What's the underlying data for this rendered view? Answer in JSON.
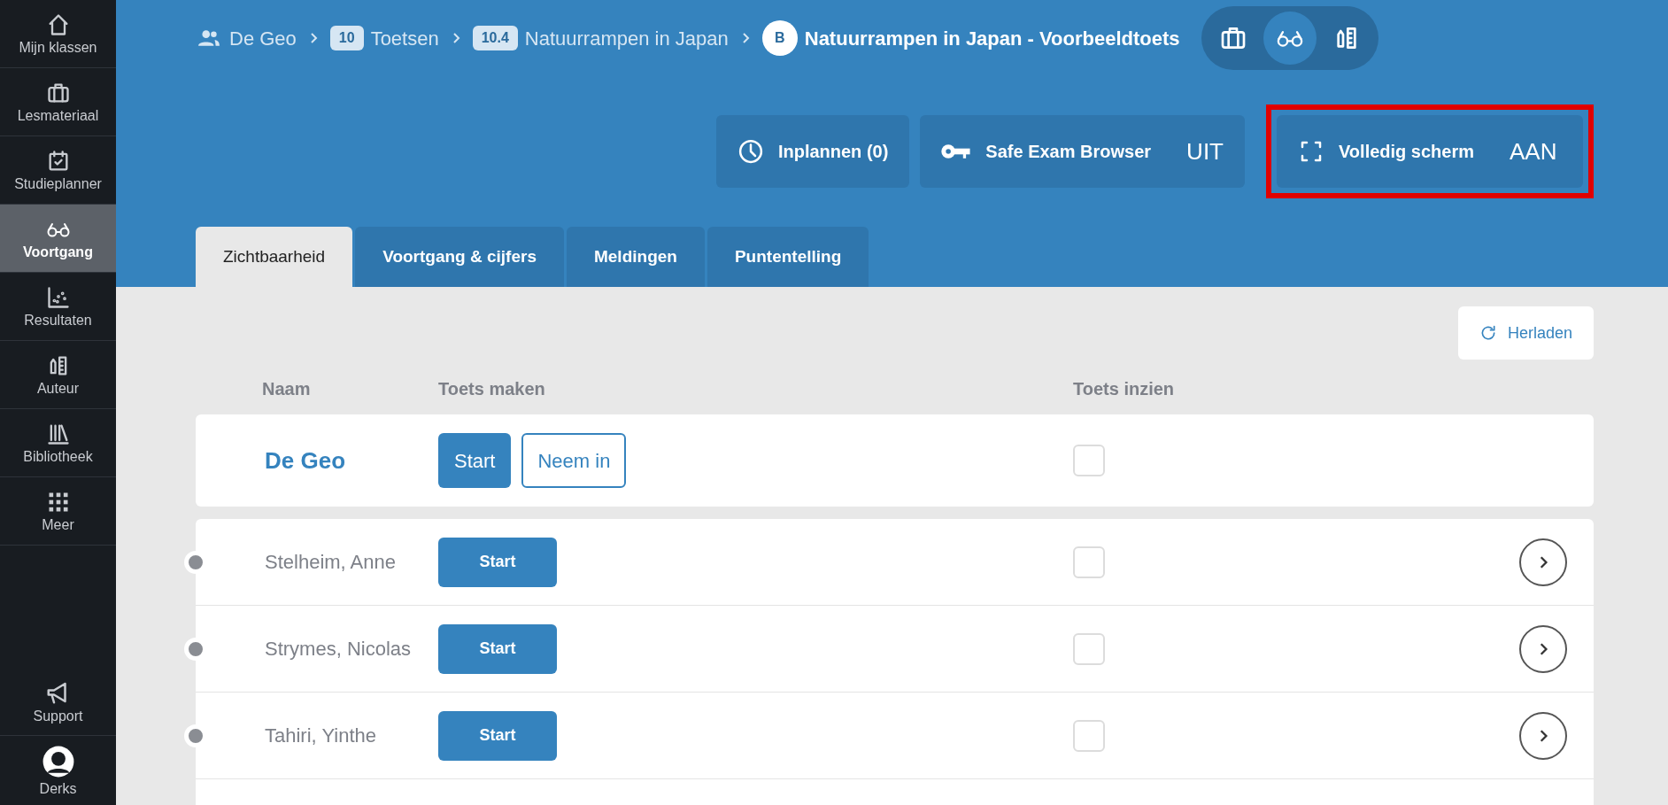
{
  "sidebar": {
    "items": [
      {
        "label": "Mijn klassen",
        "selected": false
      },
      {
        "label": "Lesmateriaal",
        "selected": false
      },
      {
        "label": "Studieplanner",
        "selected": false
      },
      {
        "label": "Voortgang",
        "selected": true
      },
      {
        "label": "Resultaten",
        "selected": false
      },
      {
        "label": "Auteur",
        "selected": false
      },
      {
        "label": "Bibliotheek",
        "selected": false
      },
      {
        "label": "Meer",
        "selected": false
      }
    ],
    "bottom": [
      {
        "label": "Support"
      },
      {
        "label": "Derks"
      }
    ]
  },
  "breadcrumb": [
    {
      "kind": "group",
      "label": "De Geo"
    },
    {
      "kind": "badge",
      "badge": "10",
      "label": "Toetsen"
    },
    {
      "kind": "badge",
      "badge": "10.4",
      "label": "Natuurrampen in Japan"
    },
    {
      "kind": "current",
      "badge": "B",
      "label": "Natuurrampen in Japan - Voorbeeldtoets"
    }
  ],
  "view_switch": [
    {
      "selected": false
    },
    {
      "selected": true
    },
    {
      "selected": false
    }
  ],
  "actions": [
    {
      "label": "Inplannen (0)",
      "highlighted": false
    },
    {
      "label": "Safe Exam Browser",
      "value": "UIT",
      "highlighted": false
    },
    {
      "label": "Volledig scherm",
      "value": "AAN",
      "highlighted": true
    }
  ],
  "tabs": [
    {
      "label": "Zichtbaarheid",
      "selected": true
    },
    {
      "label": "Voortgang & cijfers",
      "selected": false
    },
    {
      "label": "Meldingen",
      "selected": false
    },
    {
      "label": "Puntentelling",
      "selected": false
    }
  ],
  "reload_button": "Herladen",
  "table": {
    "columns": [
      "Naam",
      "Toets maken",
      "Toets inzien"
    ],
    "group": {
      "name": "De Geo",
      "start": "Start",
      "collect": "Neem in",
      "checked": false
    },
    "rows": [
      {
        "name": "Stelheim, Anne",
        "start": "Start",
        "checked": false
      },
      {
        "name": "Strymes, Nicolas",
        "start": "Start",
        "checked": false
      },
      {
        "name": "Tahiri, Yinthe",
        "start": "Start",
        "checked": false
      }
    ]
  }
}
